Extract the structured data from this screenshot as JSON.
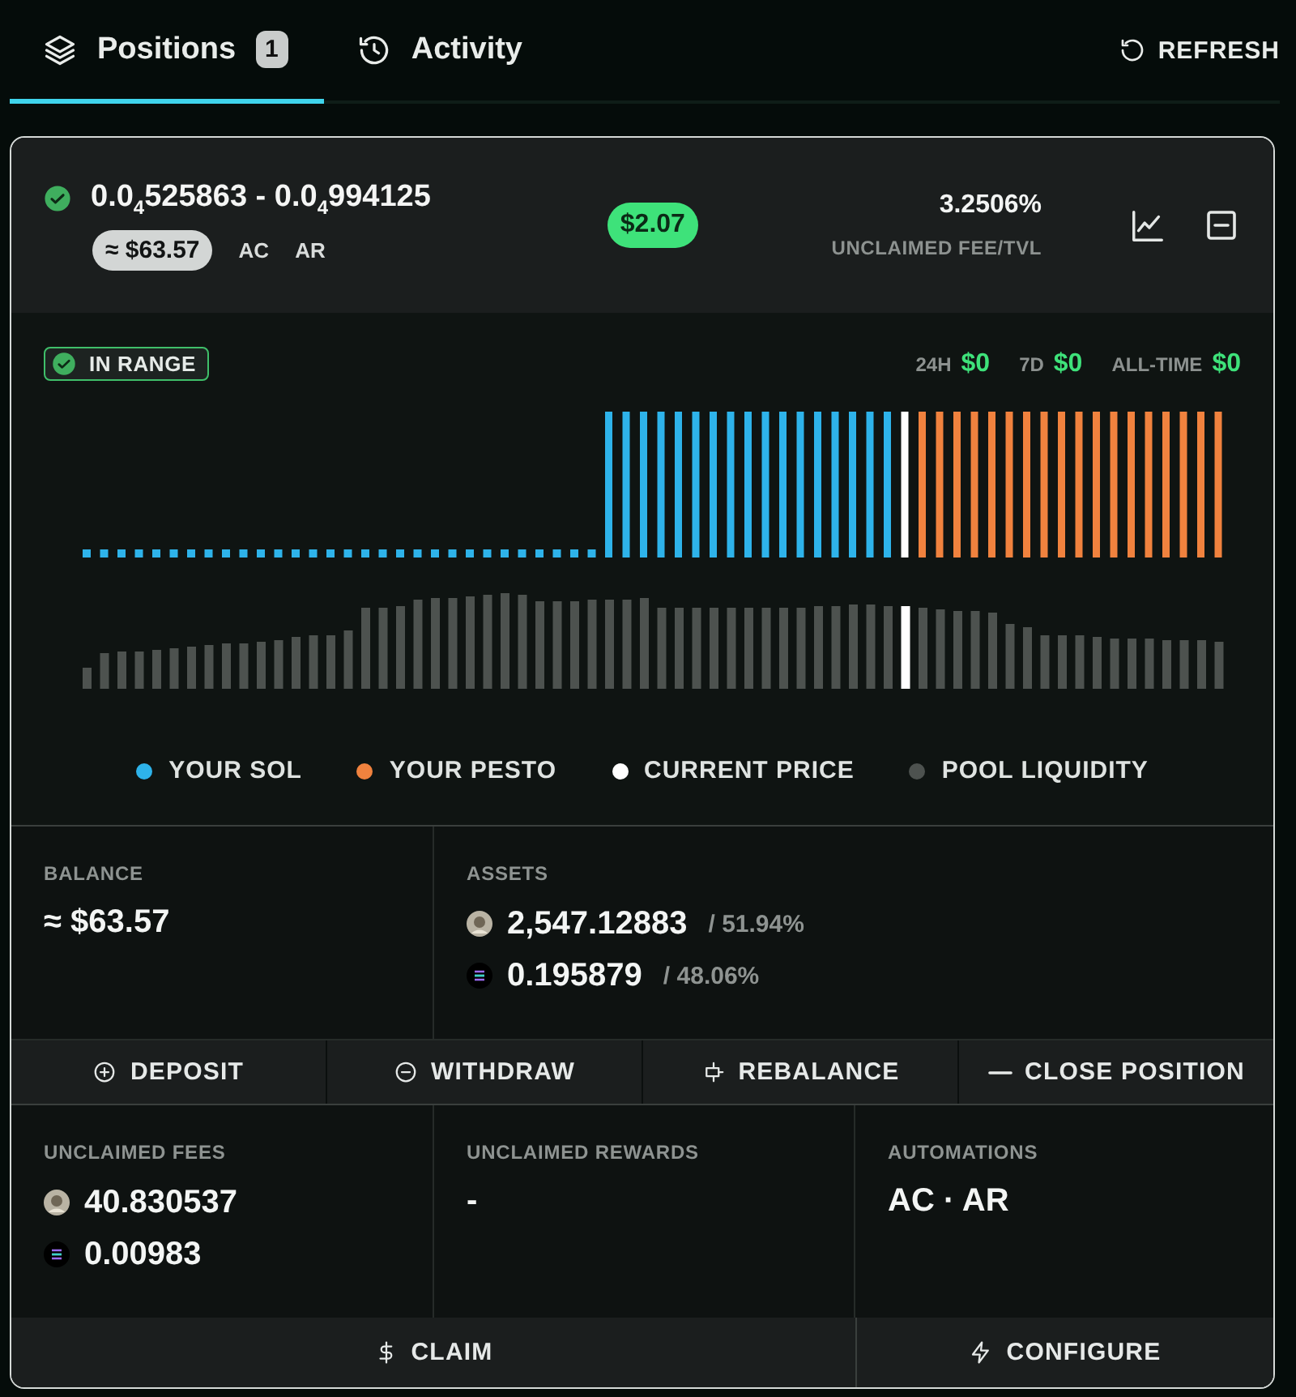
{
  "tabs": [
    {
      "label": "Positions",
      "badge": "1",
      "selected": true
    },
    {
      "label": "Activity",
      "selected": false
    }
  ],
  "refresh": "REFRESH",
  "position": {
    "range": "0.0$_{4}$525863 - 0.0$_{4}$994125",
    "value": "≈ $63.57",
    "tags": [
      "AC",
      "AR"
    ],
    "fee_badge": "$2.07",
    "fee_tvl": "3.2506%",
    "fee_tvl_label": "UNCLAIMED FEE/TVL"
  },
  "chart": {
    "status": "IN RANGE",
    "earnings": [
      {
        "period": "24H",
        "amount": "$0"
      },
      {
        "period": "7D",
        "amount": "$0"
      },
      {
        "period": "ALL-TIME",
        "amount": "$0"
      }
    ],
    "legend": [
      {
        "label": "YOUR SOL",
        "color": "#2eb3ea"
      },
      {
        "label": "YOUR PESTO",
        "color": "#f0823e"
      },
      {
        "label": "CURRENT PRICE",
        "color": "#ffffff"
      },
      {
        "label": "POOL LIQUIDITY",
        "color": "#4d524f"
      }
    ]
  },
  "balance": {
    "label": "BALANCE",
    "value": "≈ $63.57"
  },
  "assets": {
    "label": "ASSETS",
    "items": [
      {
        "amount": "2,547.12883",
        "share": "/ 51.94%"
      },
      {
        "amount": "0.195879",
        "share": "/ 48.06%"
      }
    ]
  },
  "actions": [
    {
      "label": "DEPOSIT"
    },
    {
      "label": "WITHDRAW"
    },
    {
      "label": "REBALANCE"
    },
    {
      "label": "CLOSE POSITION"
    }
  ],
  "unclaimed_fees": {
    "label": "UNCLAIMED FEES",
    "items": [
      {
        "amount": "40.830537"
      },
      {
        "amount": "0.00983"
      }
    ]
  },
  "unclaimed_rewards": {
    "label": "UNCLAIMED REWARDS",
    "value": "-"
  },
  "automations": {
    "label": "AUTOMATIONS",
    "value": "AC · AR"
  },
  "footer_actions": [
    {
      "label": "CLAIM"
    },
    {
      "label": "CONFIGURE"
    }
  ]
}
